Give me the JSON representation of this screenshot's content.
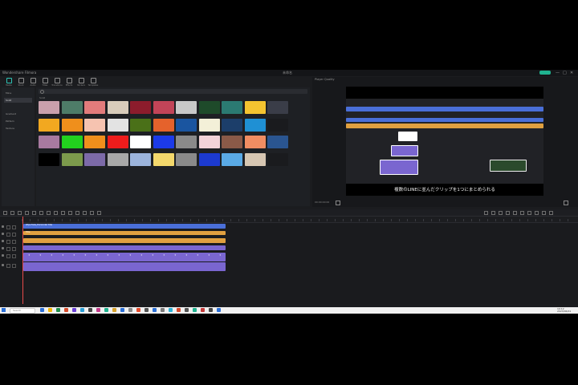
{
  "app": {
    "title": "Wondershare Filmora",
    "project_name": "未命名",
    "export_label": "Export",
    "window_controls": [
      "—",
      "□",
      "✕"
    ]
  },
  "toolbar": {
    "items": [
      {
        "label": "Media",
        "icon": "media-icon"
      },
      {
        "label": "Stock",
        "icon": "stock-icon"
      },
      {
        "label": "Audio",
        "icon": "audio-icon"
      },
      {
        "label": "Titles",
        "icon": "titles-icon"
      },
      {
        "label": "Transitions",
        "icon": "transitions-icon"
      },
      {
        "label": "Effects",
        "icon": "effects-icon"
      },
      {
        "label": "Stickers",
        "icon": "stickers-icon"
      },
      {
        "label": "Templates",
        "icon": "templates-icon"
      }
    ]
  },
  "sidebar": {
    "items": [
      {
        "label": "Mine"
      },
      {
        "label": "Solid"
      },
      {
        "label": "Gradient"
      },
      {
        "label": "Pattern"
      },
      {
        "label": "Texture"
      }
    ]
  },
  "library": {
    "search_placeholder": "Search",
    "section_label": "Solid",
    "swatch_colors": [
      [
        "#c9a0ac",
        "#4e7c68",
        "#e27b7b",
        "#d8ccbb",
        "#8c1c2c",
        "#c24458",
        "#c8c8c8",
        "#1e4a2a",
        "#2b7a72",
        "#f4c430",
        "#3a3d48"
      ],
      [
        "#f2a820",
        "#ef8f1c",
        "#f6c3b0",
        "#e3e3e3",
        "#4a7018",
        "#e5622c",
        "#1a55a0",
        "#f3f0d8",
        "#1c3e6a",
        "#1f90d4",
        "#1a1b1e"
      ],
      [
        "#a87aa0",
        "#22d11e",
        "#f08f1c",
        "#ee1c1c",
        "#ffffff",
        "#1c3ae8",
        "#8a8a8a",
        "#f3d3d8",
        "#8a5a48",
        "#f08d62",
        "#2a5590"
      ],
      [
        "#000000",
        "#7c9a4c",
        "#7c6aa8",
        "#a8a8a8",
        "#9cb4dc",
        "#f4d86c",
        "#8a8a8a",
        "#1c3ad0",
        "#5aaae6",
        "#d6c6b2",
        "#1a1b1e"
      ]
    ]
  },
  "preview": {
    "tabs": [
      "Player",
      "Quality"
    ],
    "subtitle": "複数のLINEに並んだクリップを1つにまとめられる",
    "time_label": "00:00:00:00"
  },
  "timeline": {
    "tracks": [
      {
        "label": "V5",
        "color": "#4a6fd8",
        "clip_label": "Wipe Fade_Horizontal Title"
      },
      {
        "label": "V4",
        "color": "#e0a040",
        "clip_label": "Title"
      },
      {
        "label": "V3",
        "color": "#e0a040",
        "clip_label": ""
      },
      {
        "label": "V2",
        "color": "#7a66d0",
        "clip_label": ""
      },
      {
        "label": "V1",
        "color": "#7a66d0",
        "clip_label": ""
      },
      {
        "label": "A1",
        "color": "#7a66d0",
        "clip_label": ""
      }
    ]
  },
  "taskbar": {
    "search_placeholder": "Search",
    "time": "10:12",
    "date": "2023/06/01"
  }
}
